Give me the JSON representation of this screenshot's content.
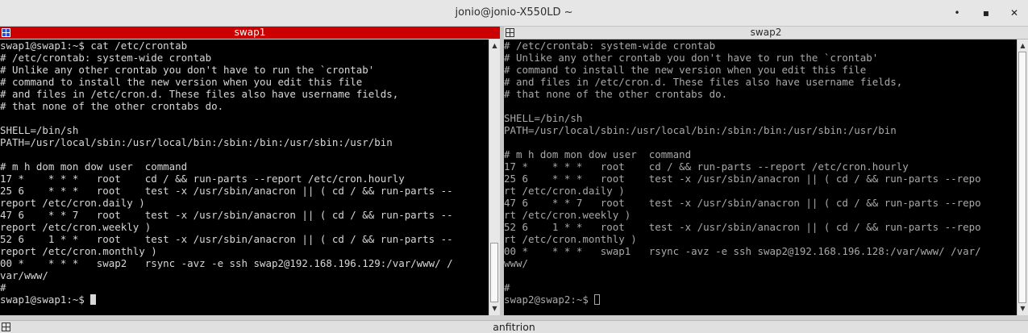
{
  "window": {
    "title": "jonio@jonio-X550LD ~",
    "minimize_glyph": "•",
    "maximize_glyph": "▪",
    "close_glyph": "✕"
  },
  "panes": [
    {
      "label": "swap1",
      "active": true,
      "lines": [
        "swap1@swap1:~$ cat /etc/crontab",
        "# /etc/crontab: system-wide crontab",
        "# Unlike any other crontab you don't have to run the `crontab'",
        "# command to install the new version when you edit this file",
        "# and files in /etc/cron.d. These files also have username fields,",
        "# that none of the other crontabs do.",
        "",
        "SHELL=/bin/sh",
        "PATH=/usr/local/sbin:/usr/local/bin:/sbin:/bin:/usr/sbin:/usr/bin",
        "",
        "# m h dom mon dow user  command",
        "17 *    * * *   root    cd / && run-parts --report /etc/cron.hourly",
        "25 6    * * *   root    test -x /usr/sbin/anacron || ( cd / && run-parts --",
        "report /etc/cron.daily )",
        "47 6    * * 7   root    test -x /usr/sbin/anacron || ( cd / && run-parts --",
        "report /etc/cron.weekly )",
        "52 6    1 * *   root    test -x /usr/sbin/anacron || ( cd / && run-parts --",
        "report /etc/cron.monthly )",
        "00 *    * * *   swap2   rsync -avz -e ssh swap2@192.168.196.129:/var/www/ /",
        "var/www/",
        "#",
        "swap1@swap1:~$ "
      ]
    },
    {
      "label": "swap2",
      "active": false,
      "lines": [
        "# /etc/crontab: system-wide crontab",
        "# Unlike any other crontab you don't have to run the `crontab'",
        "# command to install the new version when you edit this file",
        "# and files in /etc/cron.d. These files also have username fields,",
        "# that none of the other crontabs do.",
        "",
        "SHELL=/bin/sh",
        "PATH=/usr/local/sbin:/usr/local/bin:/sbin:/bin:/usr/sbin:/usr/bin",
        "",
        "# m h dom mon dow user  command",
        "17 *    * * *   root    cd / && run-parts --report /etc/cron.hourly",
        "25 6    * * *   root    test -x /usr/sbin/anacron || ( cd / && run-parts --repo",
        "rt /etc/cron.daily )",
        "47 6    * * 7   root    test -x /usr/sbin/anacron || ( cd / && run-parts --repo",
        "rt /etc/cron.weekly )",
        "52 6    1 * *   root    test -x /usr/sbin/anacron || ( cd / && run-parts --repo",
        "rt /etc/cron.monthly )",
        "00 *    * * *   swap1   rsync -avz -e ssh swap2@192.168.196.128:/var/www/ /var/",
        "www/",
        "",
        "#",
        "swap2@swap2:~$ "
      ]
    }
  ],
  "bottom": {
    "label": "anfitrion"
  },
  "colors": {
    "active_header": "#cc0000",
    "terminal_bg": "#000000",
    "active_text": "#d8d8d8",
    "inactive_text": "#a9a9a9"
  },
  "icons": {
    "pane_icon": "terminal-split-icon",
    "scroll_up": "scroll-up-arrow-icon",
    "scroll_down": "scroll-down-arrow-icon"
  }
}
